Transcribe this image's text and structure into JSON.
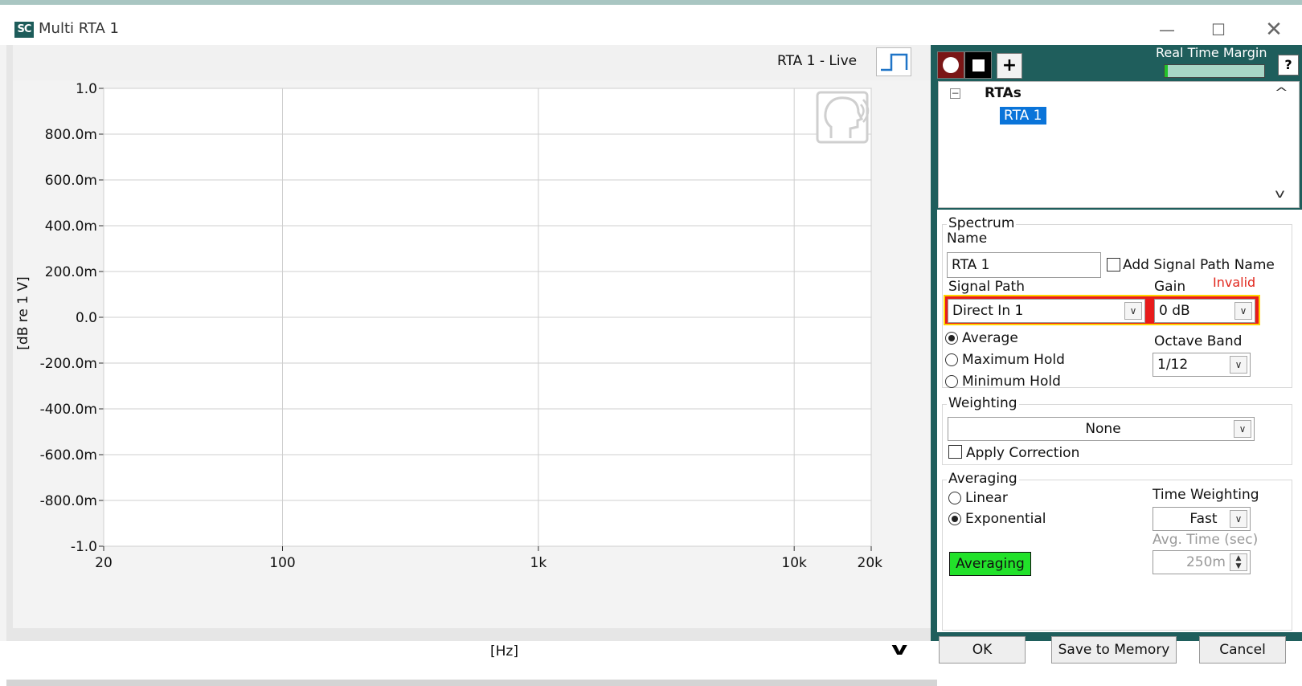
{
  "window": {
    "app_icon": "SC",
    "title": "Multi RTA 1",
    "min_glyph": "—",
    "max_glyph": "☐",
    "close_glyph": "✕"
  },
  "chart_header": {
    "live_label": "RTA 1 - Live",
    "waveform_icon": "step-waveform-icon"
  },
  "chart_data": {
    "type": "line",
    "series": [],
    "ylabel": "[dB re 1 V]",
    "xlabel": "[Hz]",
    "x_scale": "log",
    "xlim": [
      20,
      20000
    ],
    "ylim": [
      -1.0,
      1.0
    ],
    "x_ticks": [
      {
        "value": 20,
        "label": "20"
      },
      {
        "value": 100,
        "label": "100"
      },
      {
        "value": 1000,
        "label": "1k"
      },
      {
        "value": 10000,
        "label": "10k"
      },
      {
        "value": 20000,
        "label": "20k"
      }
    ],
    "y_ticks": [
      {
        "value": 1.0,
        "label": "1.0"
      },
      {
        "value": 0.8,
        "label": "800.0m"
      },
      {
        "value": 0.6,
        "label": "600.0m"
      },
      {
        "value": 0.4,
        "label": "400.0m"
      },
      {
        "value": 0.2,
        "label": "200.0m"
      },
      {
        "value": 0.0,
        "label": "0.0"
      },
      {
        "value": -0.2,
        "label": "-200.0m"
      },
      {
        "value": -0.4,
        "label": "-400.0m"
      },
      {
        "value": -0.6,
        "label": "-600.0m"
      },
      {
        "value": -0.8,
        "label": "-800.0m"
      },
      {
        "value": -1.0,
        "label": "-1.0"
      }
    ],
    "grid": true
  },
  "toolbar": {
    "record_icon": "record-icon",
    "stop_icon": "stop-icon",
    "add_label": "+",
    "real_time_margin_label": "Real Time Margin",
    "real_time_margin_fraction": 0.03,
    "help_label": "?"
  },
  "tree": {
    "toggle": "−",
    "root_label": "RTAs",
    "child_label": "RTA 1",
    "scroll_up": "^",
    "scroll_down": "v"
  },
  "spectrum": {
    "group_title": "Spectrum",
    "name_label": "Name",
    "name_value": "RTA 1",
    "add_signal_path_label": "Add Signal Path Name",
    "signal_path_label": "Signal Path",
    "signal_path_value": "Direct In 1",
    "gain_label": "Gain",
    "gain_value": "0 dB",
    "invalid_label": "Invalid",
    "modes": [
      "Average",
      "Maximum Hold",
      "Minimum Hold"
    ],
    "selected_mode": "Average",
    "octave_band_label": "Octave Band",
    "octave_band_value": "1/12"
  },
  "weighting": {
    "group_title": "Weighting",
    "value": "None",
    "apply_correction_label": "Apply Correction"
  },
  "averaging": {
    "group_title": "Averaging",
    "modes": [
      "Linear",
      "Exponential"
    ],
    "selected_mode": "Exponential",
    "time_weighting_label": "Time Weighting",
    "time_weighting_value": "Fast",
    "avg_time_label": "Avg. Time (sec)",
    "avg_time_value": "250m",
    "status_badge": "Averaging"
  },
  "footer": {
    "ok_label": "OK",
    "save_label": "Save to Memory",
    "cancel_label": "Cancel"
  },
  "colors": {
    "panel_teal": "#1f5e5c",
    "record_red": "#7a1616",
    "selection_blue": "#0a74d9",
    "error_red": "#e1261c",
    "error_outline": "#ffd400",
    "averaging_green": "#22e12a"
  }
}
